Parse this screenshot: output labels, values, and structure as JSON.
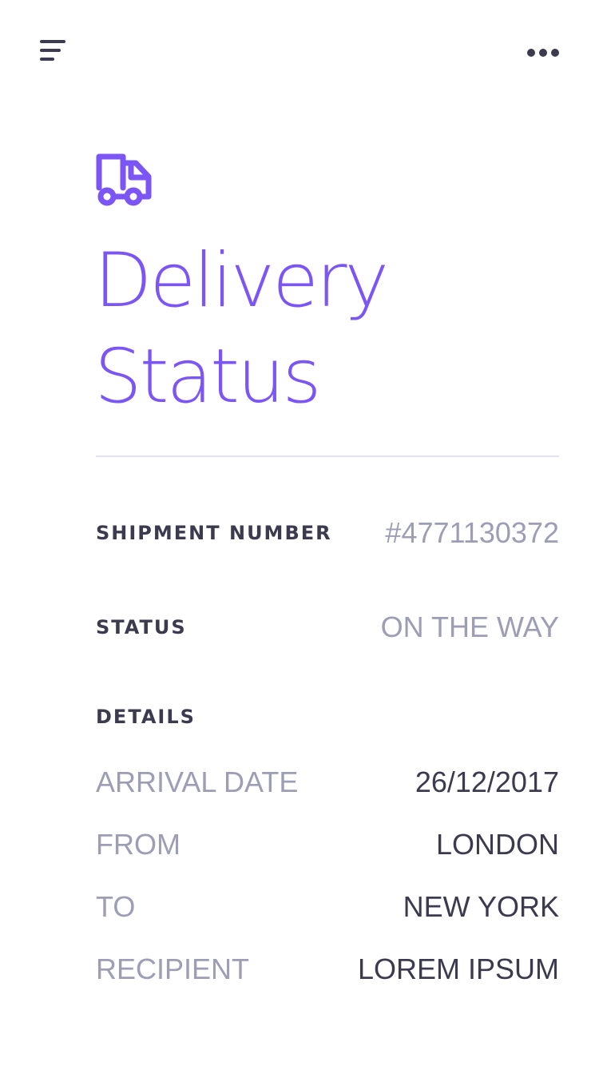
{
  "header": {
    "menu_icon": "menu-icon",
    "more_icon": "more-horizontal-icon"
  },
  "hero": {
    "icon": "truck-icon",
    "title_line1": "Delivery",
    "title_line2": "Status"
  },
  "shipment": {
    "number_label": "SHIPMENT NUMBER",
    "number_value": "#4771130372",
    "status_label": "STATUS",
    "status_value": "ON THE WAY"
  },
  "details": {
    "heading": "DETAILS",
    "rows": [
      {
        "label": "ARRIVAL DATE",
        "value": "26/12/2017"
      },
      {
        "label": "FROM",
        "value": "LONDON"
      },
      {
        "label": "TO",
        "value": "NEW YORK"
      },
      {
        "label": "RECIPIENT",
        "value": "LOREM IPSUM"
      }
    ]
  },
  "colors": {
    "accent": "#7b55f5",
    "text_dark": "#3b3a4e",
    "text_muted": "#9e9db6",
    "divider": "#e3e2f4"
  }
}
